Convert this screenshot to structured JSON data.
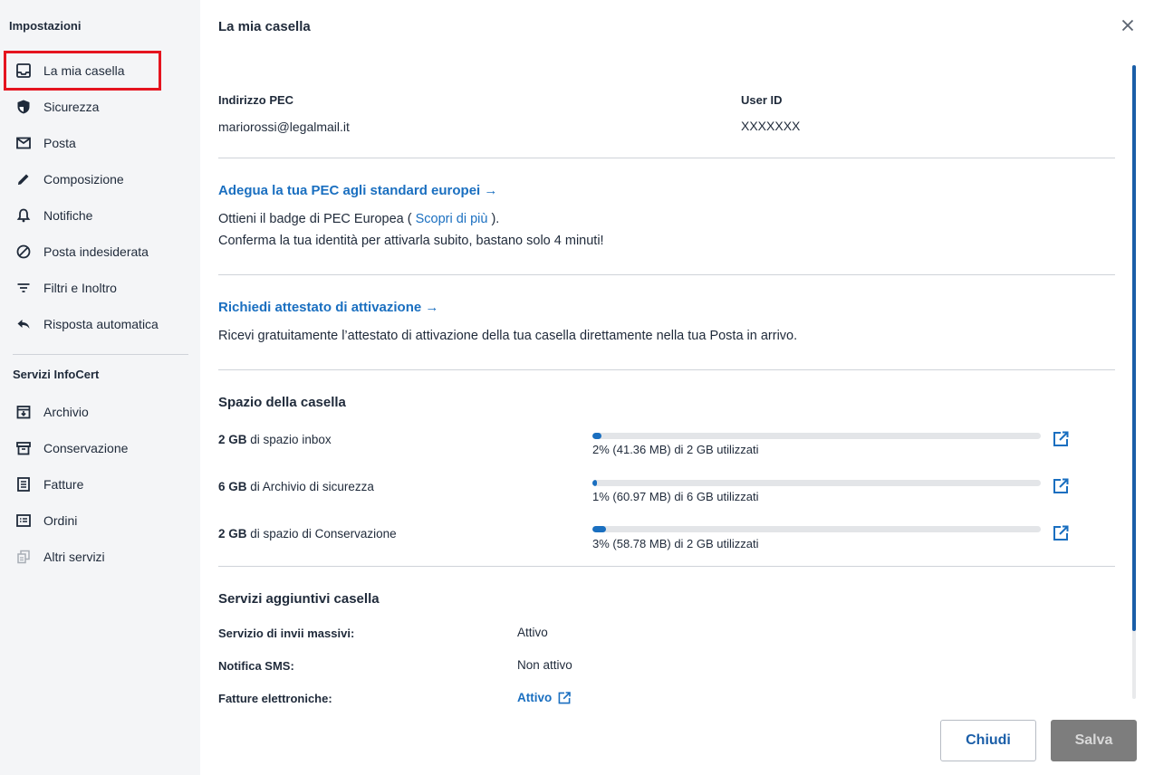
{
  "sidebar": {
    "heading": "Impostazioni",
    "items": [
      {
        "label": "La mia casella",
        "icon": "inbox-icon"
      },
      {
        "label": "Sicurezza",
        "icon": "shield-icon"
      },
      {
        "label": "Posta",
        "icon": "mail-icon"
      },
      {
        "label": "Composizione",
        "icon": "pencil-icon"
      },
      {
        "label": "Notifiche",
        "icon": "bell-icon"
      },
      {
        "label": "Posta indesiderata",
        "icon": "block-icon"
      },
      {
        "label": "Filtri e Inoltro",
        "icon": "filter-icon"
      },
      {
        "label": "Risposta automatica",
        "icon": "reply-icon"
      }
    ],
    "section_heading": "Servizi InfoCert",
    "services": [
      {
        "label": "Archivio",
        "icon": "archive-icon"
      },
      {
        "label": "Conservazione",
        "icon": "box-icon"
      },
      {
        "label": "Fatture",
        "icon": "invoice-icon"
      },
      {
        "label": "Ordini",
        "icon": "orders-icon"
      },
      {
        "label": "Altri servizi",
        "icon": "services-icon"
      }
    ]
  },
  "main": {
    "title": "La mia casella",
    "pec_label": "Indirizzo PEC",
    "pec_value": "mariorossi@legalmail.it",
    "userid_label": "User ID",
    "userid_value": "XXXXXXX",
    "promo1": {
      "title": "Adegua la tua PEC agli standard europei",
      "line1_prefix": "Ottieni il badge di PEC Europea (",
      "line1_link": "Scopri di più",
      "line1_suffix": ").",
      "line2": "Conferma la tua identità per attivarla subito, bastano solo 4 minuti!"
    },
    "promo2": {
      "title": "Richiedi attestato di attivazione",
      "text": "Ricevi gratuitamente l’attestato di attivazione della tua casella direttamente nella tua Posta in arrivo."
    },
    "storage": {
      "title": "Spazio della casella",
      "rows": [
        {
          "size": "2 GB",
          "label": "di spazio inbox",
          "percent": 2,
          "caption": "2% (41.36 MB) di 2 GB utilizzati"
        },
        {
          "size": "6 GB",
          "label": "di Archivio di sicurezza",
          "percent": 1,
          "caption": "1% (60.97 MB) di 6 GB utilizzati"
        },
        {
          "size": "2 GB",
          "label": "di spazio di Conservazione",
          "percent": 3,
          "caption": "3% (58.78 MB) di 2 GB utilizzati"
        }
      ]
    },
    "services": {
      "title": "Servizi aggiuntivi casella",
      "rows": [
        {
          "label": "Servizio di invii massivi:",
          "value": "Attivo"
        },
        {
          "label": "Notifica SMS:",
          "value": "Non attivo"
        },
        {
          "label": "Fatture elettroniche:",
          "value": "Attivo"
        }
      ]
    },
    "buttons": {
      "close": "Chiudi",
      "save": "Salva"
    }
  },
  "colors": {
    "accent": "#1a6fc0",
    "highlight": "#e5141f",
    "disabled": "#7d7d7d"
  }
}
